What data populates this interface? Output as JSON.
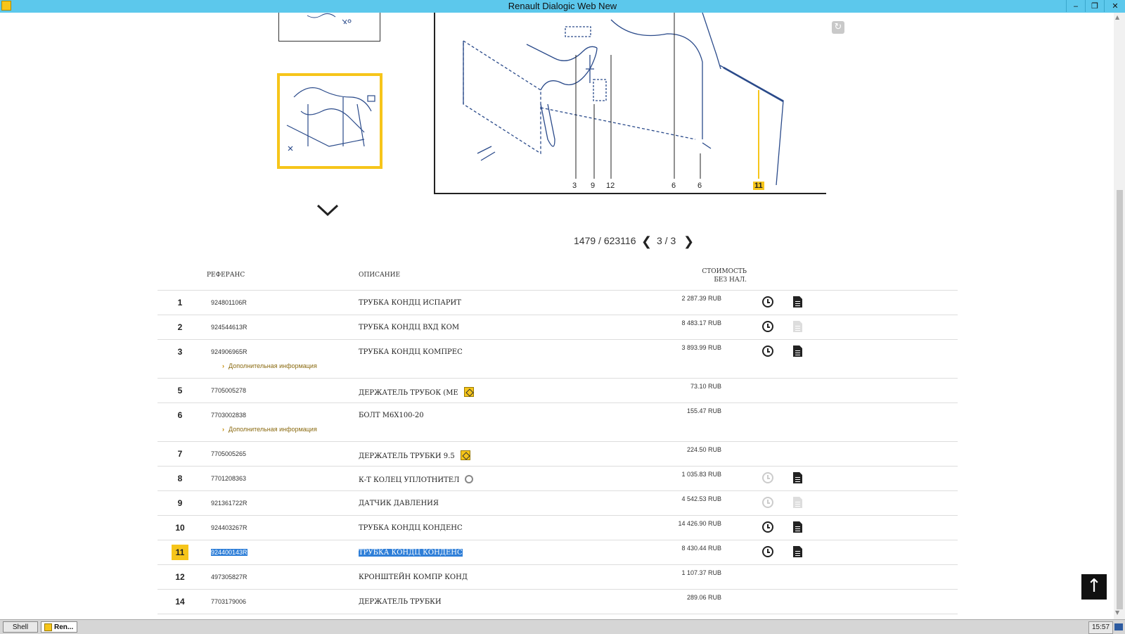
{
  "window": {
    "title": "Renault Dialogic Web New",
    "minimize": "‒",
    "restore": "❐",
    "close": "✕"
  },
  "drawing": {
    "callouts": [
      "3",
      "9",
      "12",
      "6",
      "6",
      "11"
    ],
    "highlighted_callout": "11"
  },
  "pager": {
    "count": "1479 / 623116",
    "page": "3 / 3"
  },
  "table": {
    "headers": {
      "ref": "РЕФЕРАНС",
      "desc": "ОПИСАНИЕ",
      "price_line1": "СТОИМОСТЬ",
      "price_line2": "БЕЗ НАЛ."
    },
    "extra_info_label": "Дополнительная информация",
    "rows": [
      {
        "num": "1",
        "ref": "924801106R",
        "desc": "ТРУБКА КОНДЦ ИСПАРИТ",
        "price": "2 287.39 RUB"
      },
      {
        "num": "2",
        "ref": "924544613R",
        "desc": "ТРУБКА КОНДЦ ВХД КОМ",
        "price": "8 483.17 RUB"
      },
      {
        "num": "3",
        "ref": "924906965R",
        "desc": "ТРУБКА КОНДЦ КОМПРЕС",
        "price": "3 893.99 RUB"
      },
      {
        "num": "5",
        "ref": "7705005278",
        "desc": "ДЕРЖАТЕЛЬ ТРУБОК (МЕ",
        "price": "73.10 RUB"
      },
      {
        "num": "6",
        "ref": "7703002838",
        "desc": "БОЛТ М6Х100-20",
        "price": "155.47 RUB"
      },
      {
        "num": "7",
        "ref": "7705005265",
        "desc": "ДЕРЖАТЕЛЬ ТРУБКИ 9.5",
        "price": "224.50 RUB"
      },
      {
        "num": "8",
        "ref": "7701208363",
        "desc": "К-Т КОЛЕЦ УПЛОТНИТЕЛ",
        "price": "1 035.83 RUB"
      },
      {
        "num": "9",
        "ref": "921361722R",
        "desc": "ДАТЧИК ДАВЛЕНИЯ",
        "price": "4 542.53 RUB"
      },
      {
        "num": "10",
        "ref": "924403267R",
        "desc": "ТРУБКА КОНДЦ КОНДЕНС",
        "price": "14 426.90 RUB"
      },
      {
        "num": "11",
        "ref": "924400143R",
        "desc": "ТРУБКА КОНДЦ КОНДЕНС",
        "price": "8 430.44 RUB"
      },
      {
        "num": "12",
        "ref": "497305827R",
        "desc": "КРОНШТЕЙН КОМПР КОНД",
        "price": "1 107.37 RUB"
      },
      {
        "num": "14",
        "ref": "7703179006",
        "desc": "ДЕРЖАТЕЛЬ ТРУБКИ",
        "price": "289.06 RUB"
      }
    ]
  },
  "taskbar": {
    "item1": "Shell",
    "item2": "Ren...",
    "clock": "15:57"
  },
  "colors": {
    "titlebar": "#5cc8ec",
    "highlight": "#f6c51a",
    "selection": "#2f7fd8"
  }
}
